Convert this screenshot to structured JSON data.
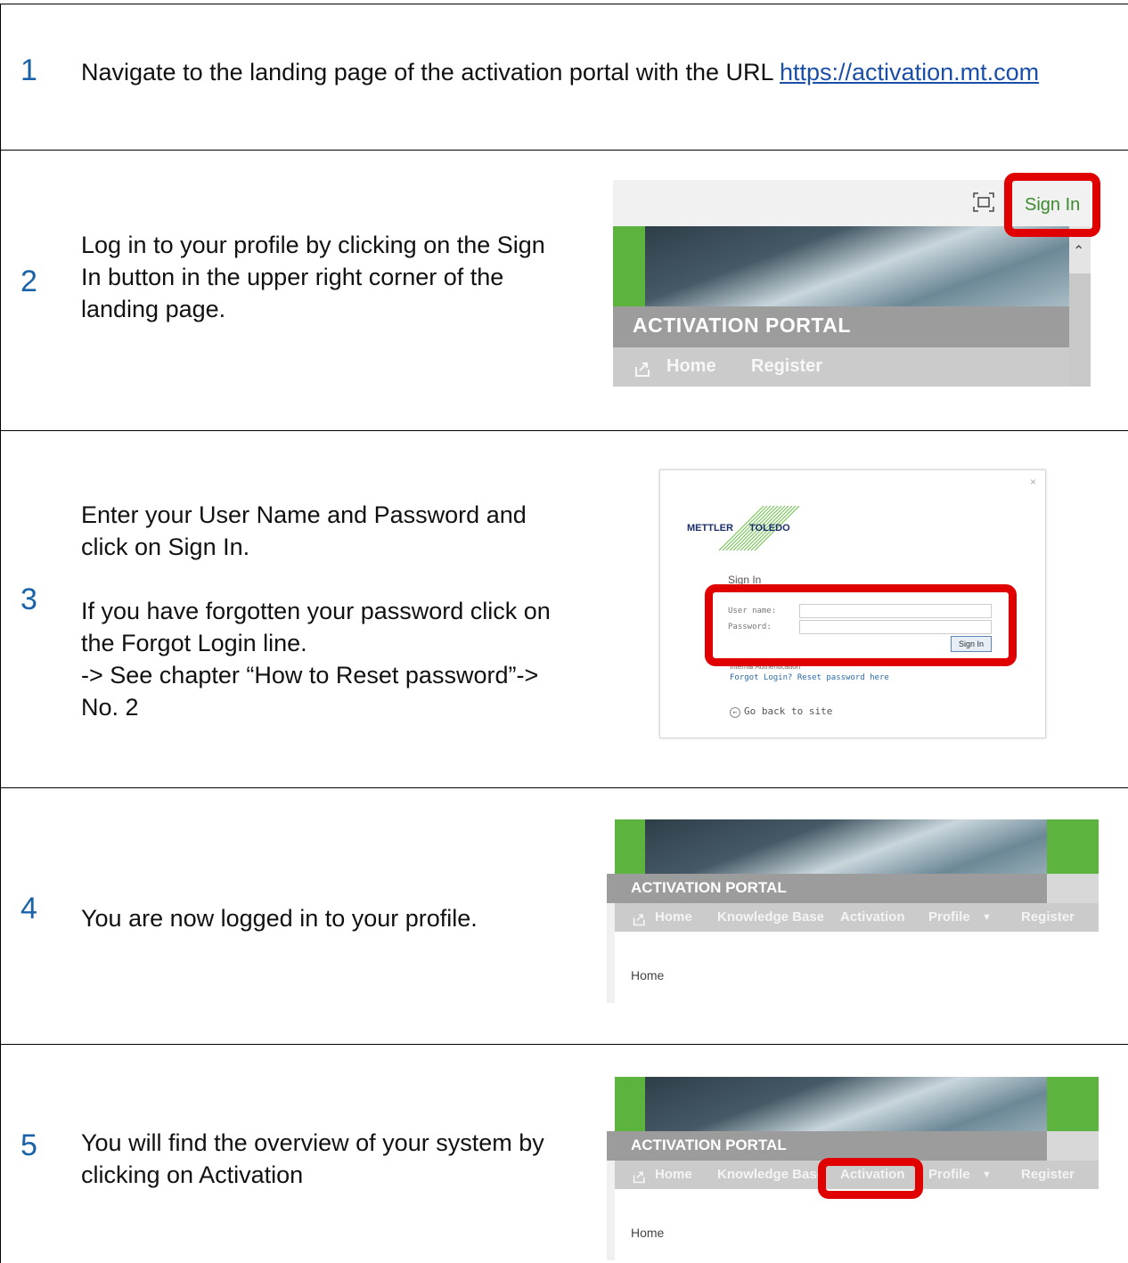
{
  "steps": [
    {
      "number": "1",
      "text": "Navigate to the landing page of the activation portal with the URL ",
      "url": "https://activation.mt.com"
    },
    {
      "number": "2",
      "line1_pre": "Log in to your profile by clicking on the ",
      "line1_bold": "Sign",
      "line2_bold": "In",
      "line2_post": " button in the upper right corner of the",
      "line3": "landing page."
    },
    {
      "number": "3",
      "p1_line1": "Enter your User Name and Password and",
      "p1_line2_pre": "click on ",
      "p1_line2_bold": "Sign In.",
      "p2_line1": "If you have forgotten your password click on",
      "p2_line2_pre": "the ",
      "p2_line2_bold": "Forgot Login",
      "p2_line2_post": " line.",
      "p2_line3": "-> See chapter “How to Reset password”->",
      "p2_line4": "No. 2"
    },
    {
      "number": "4",
      "text": "You are now logged in to your profile."
    },
    {
      "number": "5",
      "line1": "You will find the overview of your system by",
      "line2": "clicking on Activation"
    }
  ],
  "landing_shot": {
    "sign_in": "Sign In",
    "portal_title": "ACTIVATION PORTAL",
    "nav": [
      "Home",
      "Register"
    ],
    "fullscreen_icon": "fullscreen-icon",
    "scroll_up_icon": "chevron-up-icon"
  },
  "login_shot": {
    "close": "×",
    "logo_left": "METTLER",
    "logo_right": "TOLEDO",
    "heading": "Sign In",
    "user_label": "User name:",
    "password_label": "Password:",
    "button": "Sign In",
    "internal": "Internal Authentication",
    "forgot": "Forgot Login? Reset password here",
    "back": "Go back to site"
  },
  "portal_shot": {
    "portal_title": "ACTIVATION PORTAL",
    "nav": [
      "Home",
      "Knowledge Base",
      "Activation",
      "Profile",
      "Register"
    ],
    "dropdown_icon": "caret-down-icon",
    "breadcrumb": "Home"
  },
  "colors": {
    "highlight": "#e00000",
    "step_number": "#1a62a8",
    "brand_green": "#5cb43e"
  }
}
